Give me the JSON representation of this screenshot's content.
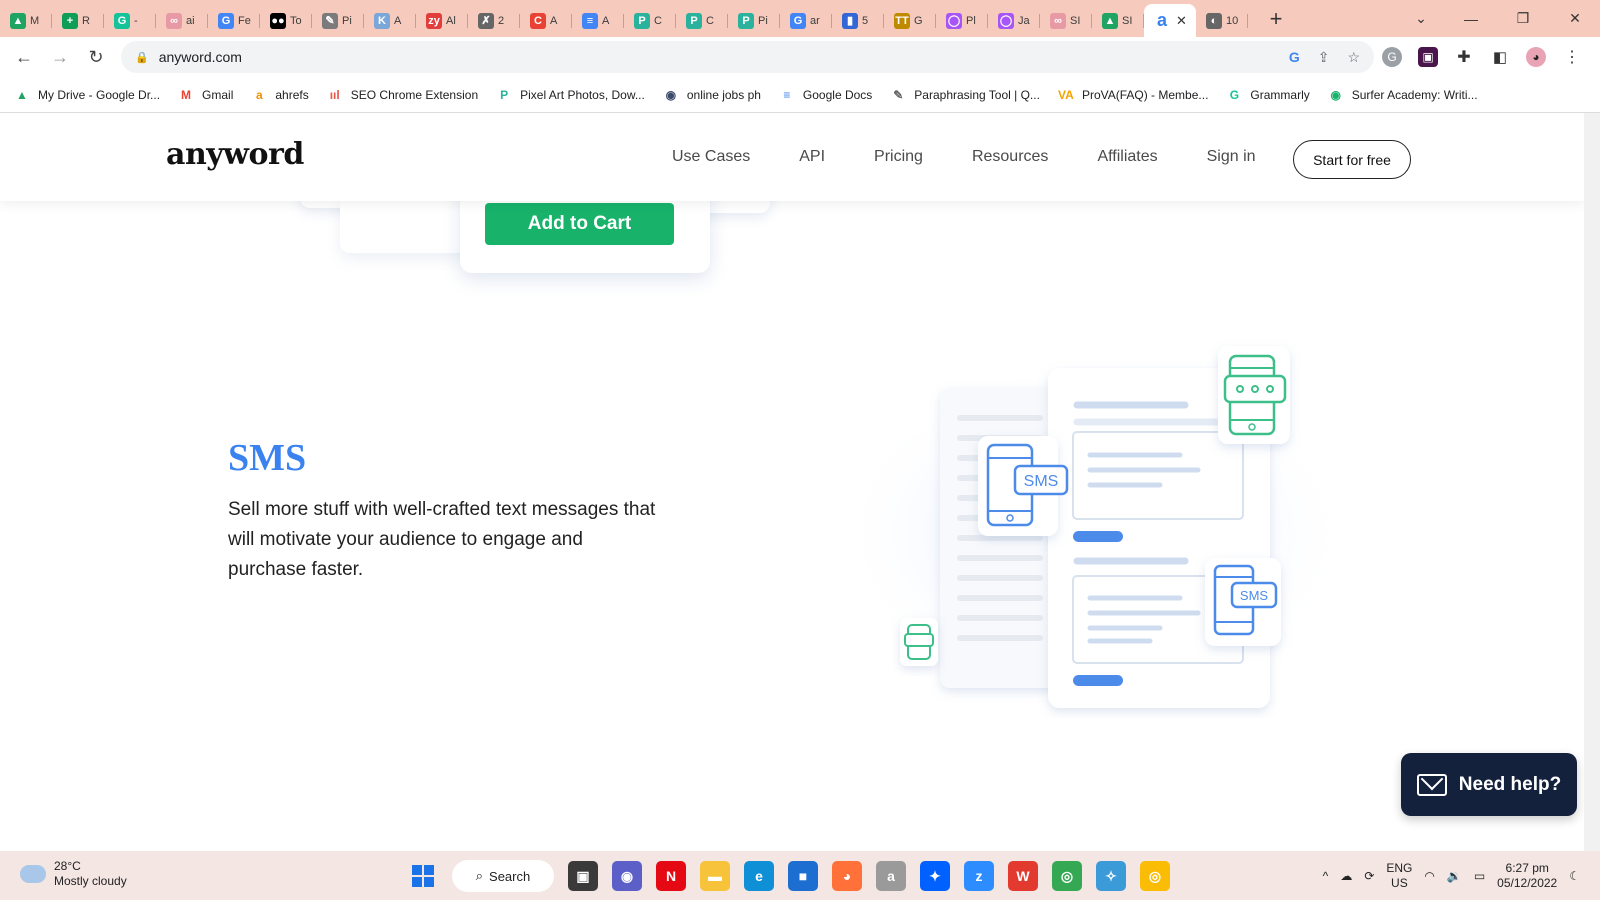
{
  "browser": {
    "tabs": [
      {
        "fav": "▲",
        "color": "#1fa463",
        "title": "M"
      },
      {
        "fav": "+",
        "color": "#0f9d58",
        "title": "R"
      },
      {
        "fav": "G",
        "color": "#15c39a",
        "title": "-"
      },
      {
        "fav": "∞",
        "color": "#e79aa6",
        "title": "ai"
      },
      {
        "fav": "G",
        "color": "#4285f4",
        "title": "Fe"
      },
      {
        "fav": "●●",
        "color": "#000000",
        "title": "To"
      },
      {
        "fav": "✎",
        "color": "#7b7b7b",
        "title": "Pi"
      },
      {
        "fav": "K",
        "color": "#7aa7d8",
        "title": "A"
      },
      {
        "fav": "zy",
        "color": "#e23d3d",
        "title": "Al"
      },
      {
        "fav": "✗",
        "color": "#666666",
        "title": "2"
      },
      {
        "fav": "C",
        "color": "#e94235",
        "title": "A"
      },
      {
        "fav": "≡",
        "color": "#4285f4",
        "title": "A"
      },
      {
        "fav": "P",
        "color": "#2bb29d",
        "title": "C"
      },
      {
        "fav": "P",
        "color": "#2bb29d",
        "title": "C"
      },
      {
        "fav": "P",
        "color": "#2bb29d",
        "title": "Pi"
      },
      {
        "fav": "G",
        "color": "#4285f4",
        "title": "ar"
      },
      {
        "fav": "▮",
        "color": "#3367d6",
        "title": "5"
      },
      {
        "fav": "TT",
        "color": "#c08a00",
        "title": "G"
      },
      {
        "fav": "◯",
        "color": "#a855f7",
        "title": "Pl"
      },
      {
        "fav": "◯",
        "color": "#a855f7",
        "title": "Ja"
      },
      {
        "fav": "∞",
        "color": "#e79aa6",
        "title": "SI"
      },
      {
        "fav": "▲",
        "color": "#1fa463",
        "title": "SI"
      }
    ],
    "active_tab": {
      "fav": "a",
      "color": "#3a82f0",
      "close": "✕"
    },
    "trailing_tab": {
      "fav": "◐",
      "color": "#666666",
      "title": "10"
    },
    "new_tab": "+",
    "window_controls": {
      "dropdown": "⌄",
      "minimize": "—",
      "restore": "❐",
      "close": "✕"
    },
    "nav": {
      "back": "←",
      "forward": "→",
      "reload": "↻"
    },
    "url": "anyword.com",
    "lock": "🔒",
    "omnibox_icons": {
      "google": "G",
      "share": "⇪",
      "star": "☆"
    },
    "bookmarks": [
      {
        "icon": "▲",
        "color": "#1fa463",
        "label": "My Drive - Google Dr..."
      },
      {
        "icon": "M",
        "color": "#ea4335",
        "label": "Gmail"
      },
      {
        "icon": "a",
        "color": "#f29100",
        "label": "ahrefs"
      },
      {
        "icon": "ııl",
        "color": "#e8574a",
        "label": "SEO Chrome Extension"
      },
      {
        "icon": "P",
        "color": "#2bb29d",
        "label": "Pixel Art Photos, Dow..."
      },
      {
        "icon": "◉",
        "color": "#3c4a6b",
        "label": "online jobs ph"
      },
      {
        "icon": "≡",
        "color": "#4285f4",
        "label": "Google Docs"
      },
      {
        "icon": "✎",
        "color": "#666666",
        "label": "Paraphrasing Tool | Q..."
      },
      {
        "icon": "VA",
        "color": "#f4a300",
        "label": "ProVA(FAQ) - Membe..."
      },
      {
        "icon": "G",
        "color": "#15c39a",
        "label": "Grammarly"
      },
      {
        "icon": "◉",
        "color": "#18b26b",
        "label": "Surfer Academy: Writi..."
      }
    ]
  },
  "site": {
    "logo": "anyword",
    "nav": [
      "Use Cases",
      "API",
      "Pricing",
      "Resources",
      "Affiliates",
      "Sign in"
    ],
    "cta": "Start for free"
  },
  "content": {
    "cart_button": "Add to Cart",
    "section_title": "SMS",
    "section_body": "Sell more stuff with well-crafted text messages that will motivate your audience to engage and purchase faster.",
    "illustration_badges": [
      "SMS",
      "SMS"
    ]
  },
  "help": {
    "label": "Need help?"
  },
  "taskbar": {
    "weather_temp": "28°C",
    "weather_desc": "Mostly cloudy",
    "search_label": "Search",
    "apps": [
      {
        "name": "file-explorer-dark",
        "icon": "▣",
        "color": "#3a3a3a"
      },
      {
        "name": "teams",
        "icon": "◉",
        "color": "#5b5fc7"
      },
      {
        "name": "netflix",
        "icon": "N",
        "color": "#e50914"
      },
      {
        "name": "file-explorer",
        "icon": "▬",
        "color": "#f7c33b"
      },
      {
        "name": "edge",
        "icon": "e",
        "color": "#0f8fd6"
      },
      {
        "name": "store",
        "icon": "■",
        "color": "#1c6fd1"
      },
      {
        "name": "firefox",
        "icon": "◕",
        "color": "#ff7139"
      },
      {
        "name": "amazon",
        "icon": "a",
        "color": "#9a9a9a"
      },
      {
        "name": "dropbox",
        "icon": "✦",
        "color": "#0061fe"
      },
      {
        "name": "zoom",
        "icon": "z",
        "color": "#2d8cff"
      },
      {
        "name": "wps",
        "icon": "W",
        "color": "#e33a2f"
      },
      {
        "name": "chrome",
        "icon": "◎",
        "color": "#34a853"
      },
      {
        "name": "app-blue",
        "icon": "✧",
        "color": "#3b9bd8"
      },
      {
        "name": "chrome-profile",
        "icon": "◎",
        "color": "#fbbc05"
      }
    ],
    "tray_chevron": "^",
    "language_top": "ENG",
    "language_bottom": "US",
    "time": "6:27 pm",
    "date": "05/12/2022"
  }
}
